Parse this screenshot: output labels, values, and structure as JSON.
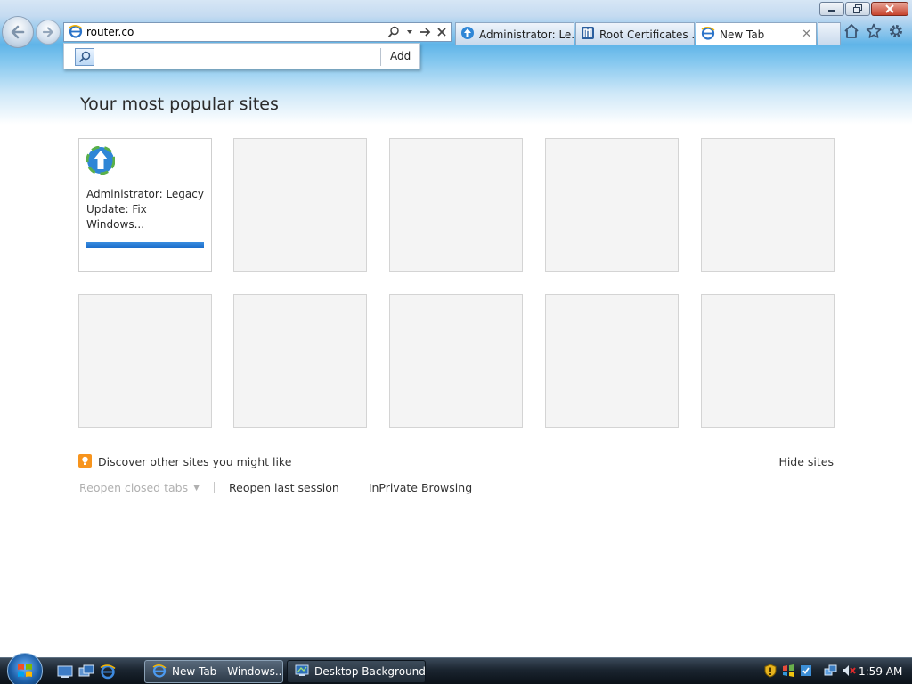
{
  "address_bar": {
    "value": "router.co",
    "placeholder": ""
  },
  "suggestion": {
    "add_label": "Add"
  },
  "tabs": [
    {
      "label": "Administrator: Le...",
      "icon": "legacy-update-icon"
    },
    {
      "label": "Root Certificates ...",
      "icon": "m-site-icon"
    },
    {
      "label": "New Tab",
      "icon": "ie-icon",
      "active": true
    }
  ],
  "page": {
    "title": "Your most popular sites",
    "tiles": [
      {
        "label": "Administrator: Legacy Update: Fix Windows...",
        "icon": "legacy-update-icon",
        "has_bar": true
      }
    ],
    "discover_label": "Discover other sites you might like",
    "hide_sites_label": "Hide sites",
    "reopen_closed_label": "Reopen closed tabs",
    "reopen_last_label": "Reopen last session",
    "inprivate_label": "InPrivate Browsing"
  },
  "taskbar": {
    "tasks": [
      {
        "label": "New Tab - Windows...",
        "icon": "ie-icon",
        "active": true
      },
      {
        "label": "Desktop Background",
        "icon": "desktop-background-icon",
        "active": false
      }
    ],
    "clock": "1:59 AM"
  },
  "colors": {
    "accent": "#1668c6",
    "discover_icon": "#f7941d",
    "disabled_text": "#b0b0b0"
  }
}
